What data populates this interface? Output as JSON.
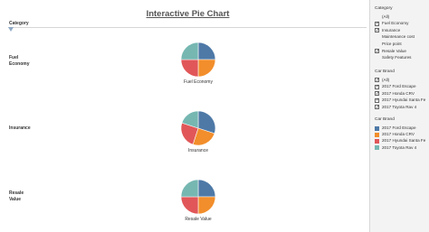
{
  "title": "Interactive Pie Chart",
  "row_header": "Category",
  "colors": {
    "ford": "#4e79a7",
    "honda": "#f28e2b",
    "hyundai": "#e15759",
    "toyota": "#76b7b2"
  },
  "filters": {
    "category": {
      "title": "Category",
      "items": [
        {
          "label": "(All)",
          "checked": false
        },
        {
          "label": "Fuel Economy",
          "checked": true
        },
        {
          "label": "Insurance",
          "checked": true
        },
        {
          "label": "Maintenance cost",
          "checked": false
        },
        {
          "label": "Price point",
          "checked": false
        },
        {
          "label": "Resale Value",
          "checked": true
        },
        {
          "label": "Safety Features",
          "checked": false
        }
      ]
    },
    "car_brand": {
      "title": "Car Brand",
      "items": [
        {
          "label": "(All)",
          "checked": true
        },
        {
          "label": "2017 Ford Escape",
          "checked": true
        },
        {
          "label": "2017 Honda CRV",
          "checked": true
        },
        {
          "label": "2017 Hyundai Santa Fe",
          "checked": true
        },
        {
          "label": "2017 Toyota Rav 4",
          "checked": true
        }
      ]
    }
  },
  "legend": {
    "title": "Car Brand",
    "items": [
      {
        "label": "2017 Ford Escape",
        "color": "#4e79a7"
      },
      {
        "label": "2017 Honda CRV",
        "color": "#f28e2b"
      },
      {
        "label": "2017 Hyundai Santa Fe",
        "color": "#e15759"
      },
      {
        "label": "2017 Toyota Rav 4",
        "color": "#76b7b2"
      }
    ]
  },
  "chart_data": {
    "type": "pie",
    "title": "Interactive Pie Chart",
    "series_names": [
      "2017 Ford Escape",
      "2017 Honda CRV",
      "2017 Hyundai Santa Fe",
      "2017 Toyota Rav 4"
    ],
    "pies": [
      {
        "category": "Fuel Economy",
        "row_label": "Fuel\nEconomy",
        "values": [
          25,
          25,
          25,
          25
        ]
      },
      {
        "category": "Insurance",
        "row_label": "Insurance",
        "values": [
          30,
          25,
          25,
          20
        ]
      },
      {
        "category": "Resale Value",
        "row_label": "Resale\nValue",
        "values": [
          25,
          25,
          25,
          25
        ]
      }
    ]
  }
}
